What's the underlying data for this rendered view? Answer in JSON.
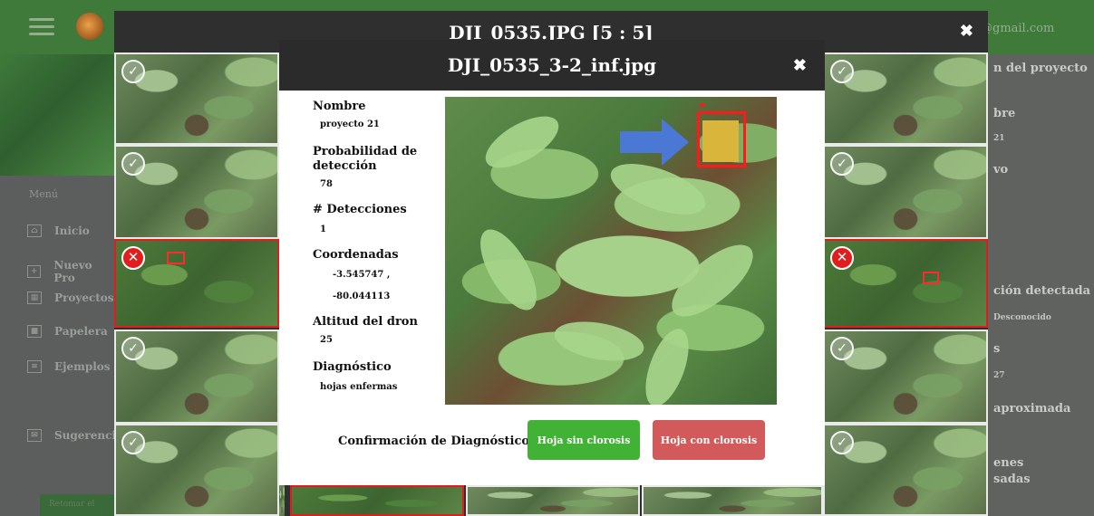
{
  "app": {
    "email_partial": "@gmail.com",
    "menu_label": "Menú",
    "menu_items": [
      "Inicio",
      "Nuevo Pro",
      "Proyectos",
      "Papelera",
      "Ejemplos",
      "Sugerencia"
    ],
    "bottom_button": "Retomar el"
  },
  "right_panel": {
    "title_partial": "n del proyecto",
    "nombre_partial": "bre",
    "nombre_val_partial": "21",
    "vo_partial": "vo",
    "afeccion_partial": "ción detectada",
    "desconocido": "Desconocido",
    "s_partial": "s",
    "num_partial": "27",
    "aprox_partial": "aproximada",
    "nes_partial": "enes",
    "procesadas_partial": "sadas"
  },
  "gallery": {
    "title": "DJI_0535.JPG [5 : 5]",
    "close": "✖"
  },
  "detail": {
    "title": "DJI_0535_3-2_inf.jpg",
    "close": "✖",
    "nombre_label": "Nombre",
    "nombre_value": "proyecto 21",
    "probabilidad_label_1": "Probabilidad de",
    "probabilidad_label_2": "detección",
    "probabilidad_value": "78",
    "detecciones_label": "# Detecciones",
    "detecciones_value": "1",
    "coordenadas_label": "Coordenadas",
    "coordenadas_lat": "-3.545747 ,",
    "coordenadas_lon": "-80.044113",
    "altitud_label": "Altitud del dron",
    "altitud_value": "25",
    "diagnostico_label": "Diagnóstico",
    "diagnostico_value": "hojas enfermas",
    "confirmacion_label": "Confirmación de Diagnóstico:",
    "btn_sin": "Hoja sin clorosis",
    "btn_con": "Hoja con clorosis"
  },
  "colors": {
    "accent_green": "#41b236",
    "accent_red": "#d25a5a",
    "detection_red": "#ff1a1a"
  }
}
